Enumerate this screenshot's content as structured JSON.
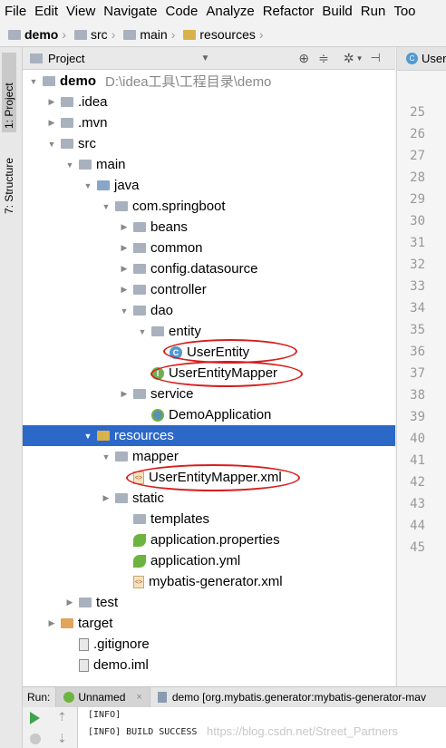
{
  "menu": [
    "File",
    "Edit",
    "View",
    "Navigate",
    "Code",
    "Analyze",
    "Refactor",
    "Build",
    "Run",
    "Too"
  ],
  "breadcrumb": [
    "demo",
    "src",
    "main",
    "resources"
  ],
  "side_tabs": {
    "project": "1: Project",
    "structure": "7: Structure"
  },
  "project_panel": {
    "title": "Project"
  },
  "tree": [
    {
      "label": "demo",
      "path": "D:\\idea工具\\工程目录\\demo",
      "depth": 0,
      "arrow": "open",
      "icon": "folder-module"
    },
    {
      "label": ".idea",
      "depth": 1,
      "arrow": "closed",
      "icon": "folder"
    },
    {
      "label": ".mvn",
      "depth": 1,
      "arrow": "closed",
      "icon": "folder"
    },
    {
      "label": "src",
      "depth": 1,
      "arrow": "open",
      "icon": "folder"
    },
    {
      "label": "main",
      "depth": 2,
      "arrow": "open",
      "icon": "folder"
    },
    {
      "label": "java",
      "depth": 3,
      "arrow": "open",
      "icon": "folder-source"
    },
    {
      "label": "com.springboot",
      "depth": 4,
      "arrow": "open",
      "icon": "package"
    },
    {
      "label": "beans",
      "depth": 5,
      "arrow": "closed",
      "icon": "package"
    },
    {
      "label": "common",
      "depth": 5,
      "arrow": "closed",
      "icon": "package"
    },
    {
      "label": "config.datasource",
      "depth": 5,
      "arrow": "closed",
      "icon": "package"
    },
    {
      "label": "controller",
      "depth": 5,
      "arrow": "closed",
      "icon": "package"
    },
    {
      "label": "dao",
      "depth": 5,
      "arrow": "open",
      "icon": "package"
    },
    {
      "label": "entity",
      "depth": 6,
      "arrow": "open",
      "icon": "package"
    },
    {
      "label": "UserEntity",
      "depth": 7,
      "arrow": "none",
      "icon": "class"
    },
    {
      "label": "UserEntityMapper",
      "depth": 6,
      "arrow": "none",
      "icon": "interface"
    },
    {
      "label": "service",
      "depth": 5,
      "arrow": "closed",
      "icon": "package"
    },
    {
      "label": "DemoApplication",
      "depth": 6,
      "arrow": "none",
      "icon": "spring-app"
    },
    {
      "label": "resources",
      "depth": 3,
      "arrow": "open",
      "icon": "folder-resources",
      "selected": true
    },
    {
      "label": "mapper",
      "depth": 4,
      "arrow": "open",
      "icon": "folder"
    },
    {
      "label": "UserEntityMapper.xml",
      "depth": 5,
      "arrow": "none",
      "icon": "xml"
    },
    {
      "label": "static",
      "depth": 4,
      "arrow": "closed",
      "icon": "folder"
    },
    {
      "label": "templates",
      "depth": 5,
      "arrow": "none",
      "icon": "folder"
    },
    {
      "label": "application.properties",
      "depth": 5,
      "arrow": "none",
      "icon": "spring-leaf"
    },
    {
      "label": "application.yml",
      "depth": 5,
      "arrow": "none",
      "icon": "spring-leaf"
    },
    {
      "label": "mybatis-generator.xml",
      "depth": 5,
      "arrow": "none",
      "icon": "xml"
    },
    {
      "label": "test",
      "depth": 2,
      "arrow": "closed",
      "icon": "folder"
    },
    {
      "label": "target",
      "depth": 1,
      "arrow": "closed",
      "icon": "folder-excluded"
    },
    {
      "label": ".gitignore",
      "depth": 2,
      "arrow": "none",
      "icon": "file"
    },
    {
      "label": "demo.iml",
      "depth": 2,
      "arrow": "none",
      "icon": "file"
    }
  ],
  "editor": {
    "tab": "User",
    "line_numbers": [
      "25",
      "26",
      "27",
      "28",
      "29",
      "30",
      "31",
      "32",
      "33",
      "34",
      "35",
      "36",
      "37",
      "38",
      "39",
      "40",
      "41",
      "42",
      "43",
      "44",
      "45"
    ]
  },
  "run": {
    "label": "Run:",
    "tab1": "Unnamed",
    "tab2": "demo [org.mybatis.generator:mybatis-generator-mav"
  },
  "console": {
    "line1": "[INFO]",
    "line2": "[INFO] BUILD SUCCESS"
  },
  "watermark": "https://blog.csdn.net/Street_Partners",
  "colors": {
    "selection": "#2c68c8",
    "annotation_circle": "#d71e1e"
  }
}
